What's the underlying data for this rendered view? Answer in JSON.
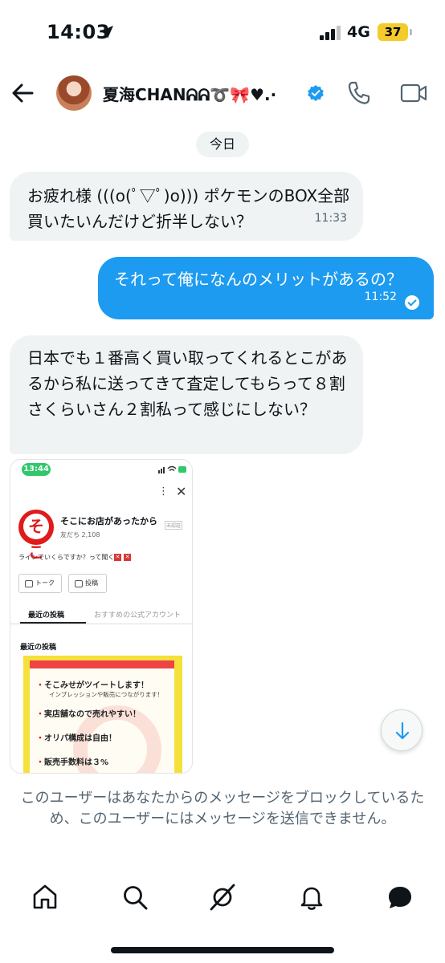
{
  "status_bar": {
    "time": "14:03",
    "network": "4G",
    "battery": "37"
  },
  "header": {
    "user_name": "夏海CHANᕱᕱ➰🎀♥︎.·"
  },
  "date_divider": "今日",
  "messages": [
    {
      "direction": "in",
      "text": "お疲れ様 (((o(ﾟ▽ﾟ)o))) ポケモンのBOX全部買いたいんだけど折半しない？",
      "time": "11:33"
    },
    {
      "direction": "out",
      "text": "それって俺になんのメリットがあるの？",
      "time": "11:52"
    },
    {
      "direction": "in",
      "text": "日本でも１番高く買い取ってくれるとこがあるから私に送ってきて査定してもらって８割さくらいさん２割私って感じにしない？"
    }
  ],
  "shared_screenshot": {
    "time": "13:44",
    "logo_text": "そこ",
    "shop_name": "そこにお店があったから",
    "badge": "未認証",
    "friends": "友だち 2,108",
    "description": "ラインでいくらですか？って聞くな",
    "talk_button": "トーク",
    "post_button": "投稿",
    "tab_recent": "最近の投稿",
    "tab_recommended": "おすすめの公式アカウント",
    "section_title": "最近の投稿",
    "banner_lines": [
      {
        "text": "そこみせがツイートします！",
        "sub": "インプレッションや販売につながります！"
      },
      {
        "text": "実店舗なので売れやすい！",
        "sub": ""
      },
      {
        "text": "オリパ構成は自由！",
        "sub": ""
      },
      {
        "text": "販売手数料は３%",
        "sub": ""
      }
    ]
  },
  "blocked_notice": "このユーザーはあなたからのメッセージをブロックしているため、このユーザーにはメッセージを送信できません。",
  "colors": {
    "accent": "#1d9bf0",
    "incoming_bubble": "#eff3f4",
    "muted_text": "#536471"
  }
}
